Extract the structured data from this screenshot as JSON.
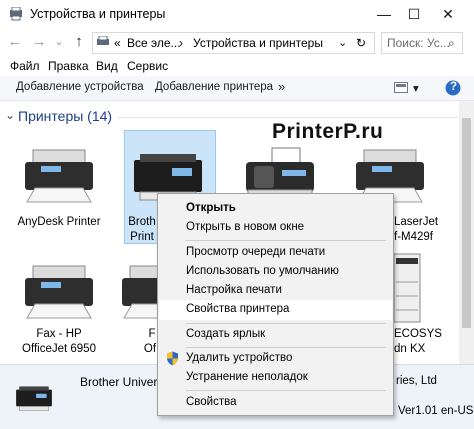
{
  "window": {
    "title": "Устройства и принтеры",
    "minimize": "—",
    "maximize": "☐",
    "close": "✕"
  },
  "nav": {
    "back": "←",
    "forward": "→",
    "recent": "⌄",
    "up": "↑",
    "breadcrumb_root": "«",
    "breadcrumb_1": "Все эле...",
    "breadcrumb_sep": "›",
    "breadcrumb_2": "Устройства и принтеры",
    "dropdown": "⌄",
    "refresh": "↻",
    "search_placeholder": "Поиск: Ус...",
    "search_icon": "⌕"
  },
  "menubar": [
    "Файл",
    "Правка",
    "Вид",
    "Сервис"
  ],
  "toolbar": {
    "add_device": "Добавление устройства",
    "add_printer": "Добавление принтера",
    "more": "»",
    "view_arrow": "▾",
    "help": "?"
  },
  "group": {
    "title": "Принтеры (14)",
    "chevron": "⌄"
  },
  "devices": {
    "row1": [
      {
        "label_1": "AnyDesk Printer",
        "label_2": ""
      },
      {
        "label_1": "Broth",
        "label_2": "Print"
      },
      {
        "label_1": "",
        "label_2": ""
      },
      {
        "label_1": "LaserJet",
        "label_2": "f-M429f"
      }
    ],
    "row2": [
      {
        "label_1": "Fax - HP",
        "label_2": "OfficeJet 6950"
      },
      {
        "label_1": "F",
        "label_2": "Of"
      },
      {
        "label_1": "",
        "label_2": ""
      },
      {
        "label_1": "ECOSYS",
        "label_2": "dn KX"
      }
    ]
  },
  "watermark": "PrinterP.ru",
  "details": {
    "name": "Brother Univer",
    "right_1": "ries, Ltd",
    "right_2": "Ver1.01 en-US"
  },
  "context_menu": {
    "open": "Открыть",
    "open_new_window": "Открыть в новом окне",
    "view_queue": "Просмотр очереди печати",
    "set_default": "Использовать по умолчанию",
    "print_prefs": "Настройка печати",
    "printer_props": "Свойства принтера",
    "create_shortcut": "Создать ярлык",
    "remove_device": "Удалить устройство",
    "troubleshoot": "Устранение неполадок",
    "properties": "Свойства"
  },
  "colors": {
    "accent_group_title": "#1e3f8a",
    "selection": "#cce4f7",
    "menu_bg": "#f2f2f2",
    "details_bg": "#eef3fa"
  }
}
